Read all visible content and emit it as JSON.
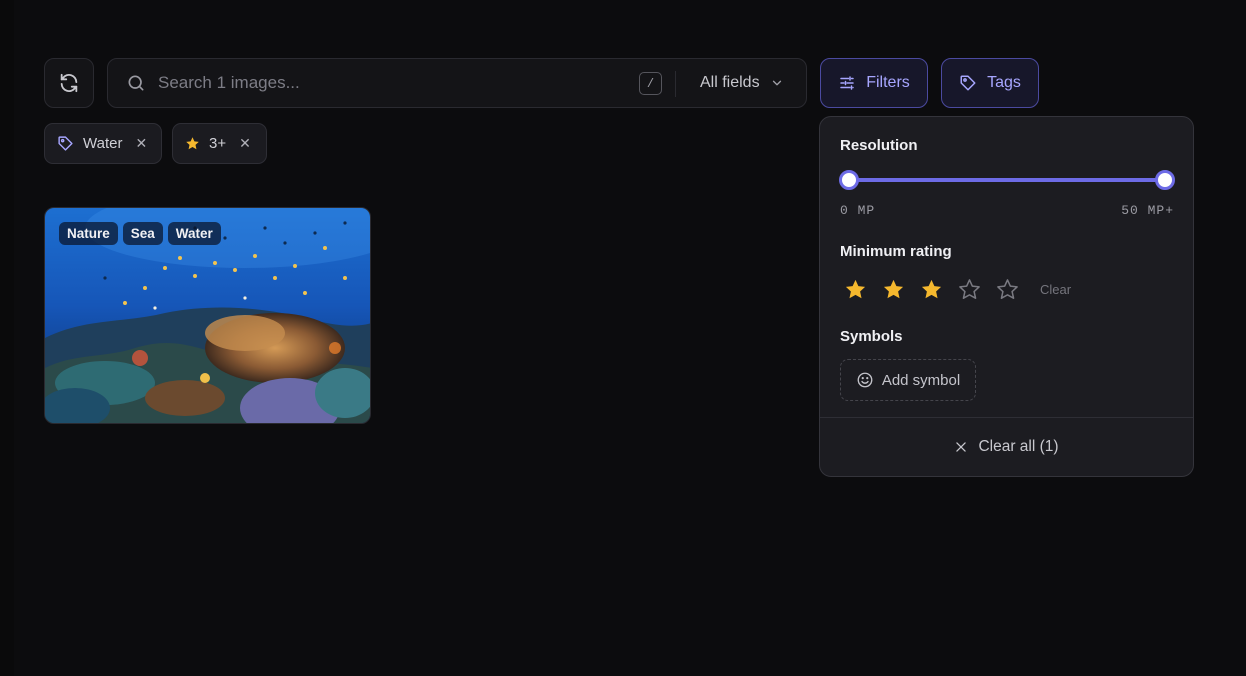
{
  "toolbar": {
    "refresh_icon": "refresh-icon",
    "search_placeholder": "Search 1 images...",
    "search_value": "",
    "shortcut_key": "/",
    "field_select": "All fields",
    "filters_label": "Filters",
    "tags_label": "Tags"
  },
  "active_filters": [
    {
      "label": "Water",
      "icon": "tag-icon"
    },
    {
      "label": "3+",
      "icon": "star-icon"
    }
  ],
  "gallery": {
    "cards": [
      {
        "tags": [
          "Nature",
          "Sea",
          "Water"
        ]
      }
    ]
  },
  "popover": {
    "resolution_label": "Resolution",
    "resolution_min": "0 MP",
    "resolution_max": "50 MP+",
    "resolution_selected": [
      0,
      50
    ],
    "rating_label": "Minimum rating",
    "rating_value": 3,
    "rating_max": 5,
    "rating_clear": "Clear",
    "symbols_label": "Symbols",
    "add_symbol": "Add symbol",
    "clear_all": "Clear all (1)"
  },
  "colors": {
    "accent": "#6d6be6",
    "accent_text": "#a7a6ff",
    "star_filled": "#f5b82e",
    "background": "#0c0c0e",
    "panel": "#1c1c21"
  }
}
